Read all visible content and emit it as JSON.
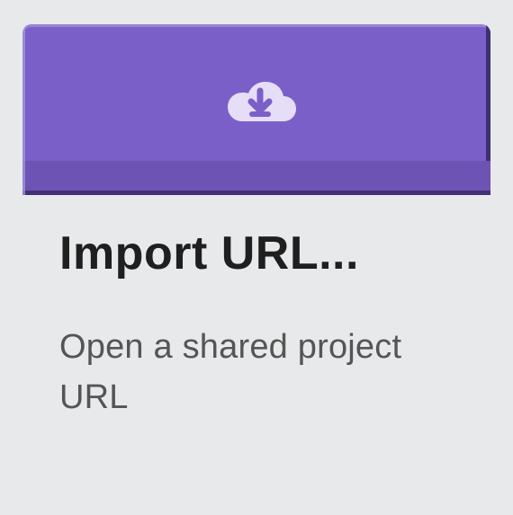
{
  "card": {
    "title": "Import URL...",
    "subtitle": "Open a shared project URL",
    "icon": "cloud-download-icon",
    "accent_color": "#7b5fc9",
    "accent_dark": "#6c53b4",
    "background": "#e8e9eb"
  }
}
